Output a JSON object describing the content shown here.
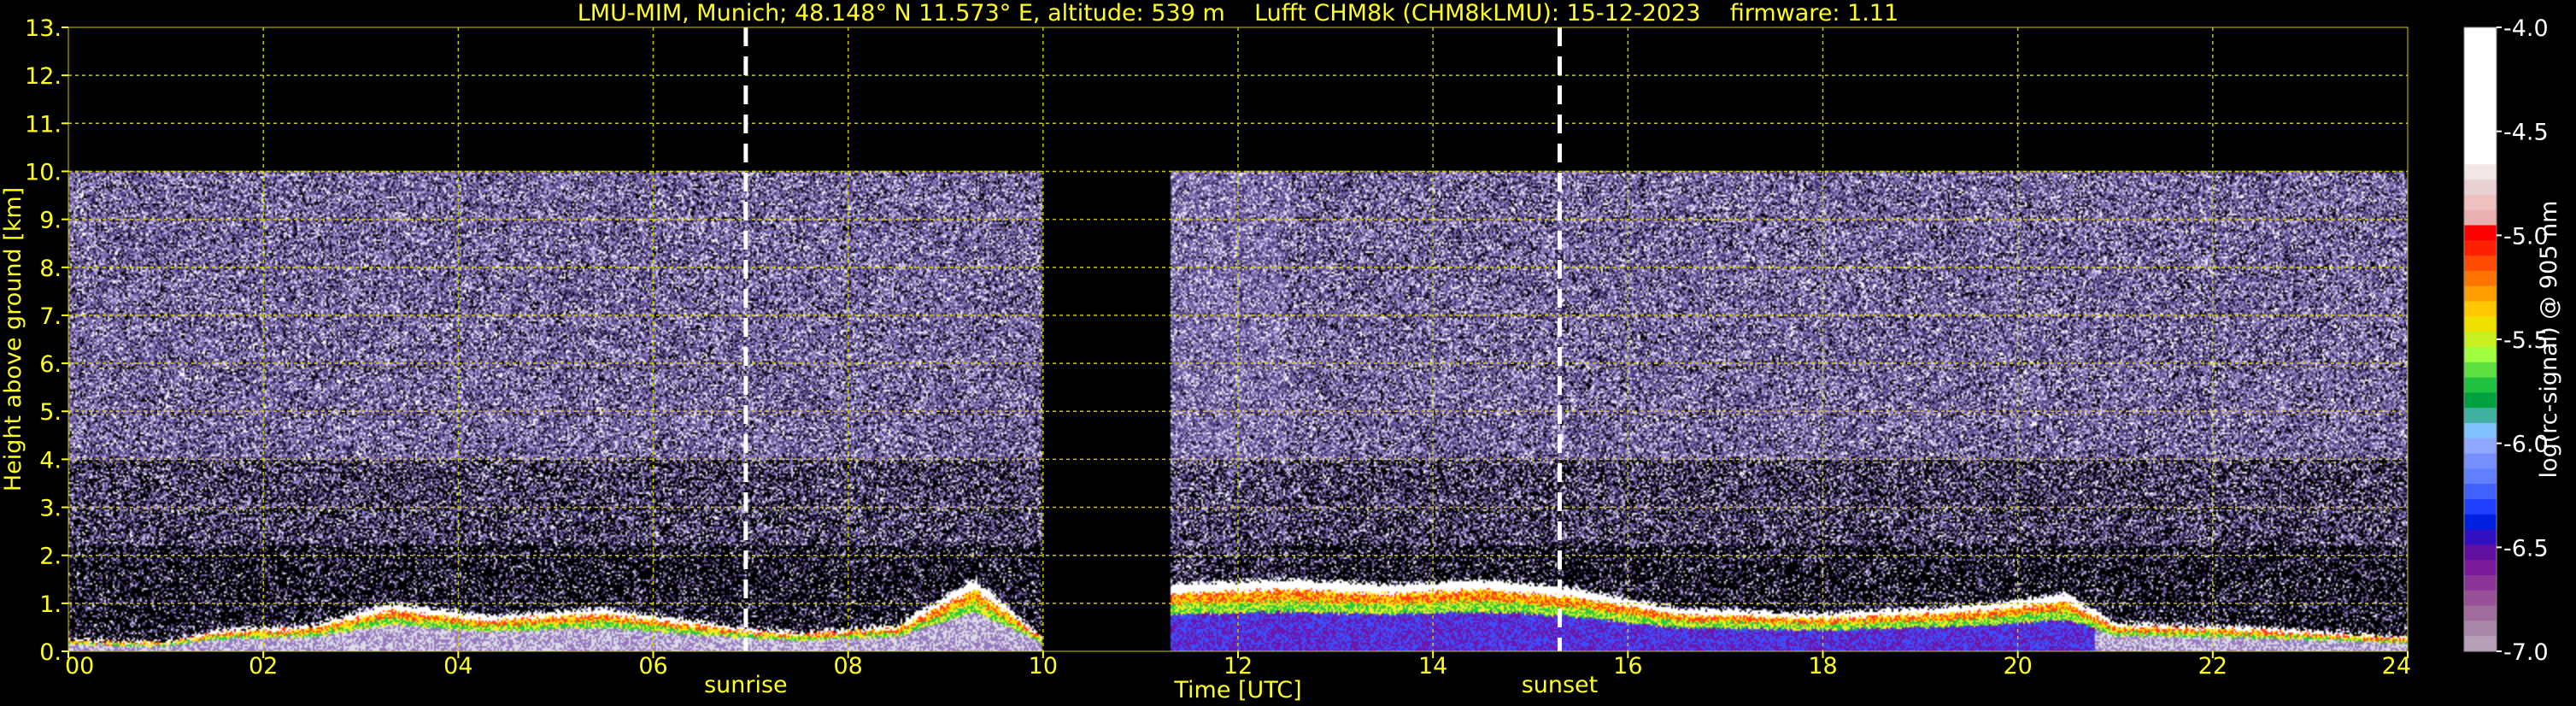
{
  "header": {
    "title": "LMU-MIM, Munich; 48.148° N 11.573° E, altitude: 539 m    Lufft CHM8k (CHM8kLMU): 15-12-2023    firmware: 1.11"
  },
  "colors": {
    "axis_text": "#ffff22",
    "grid": "#c8c800",
    "background": "#000000",
    "marker": "#ffffff",
    "colorbar_text": "#ffffff"
  },
  "chart_data": {
    "type": "heatmap",
    "title": "LMU-MIM, Munich; 48.148° N 11.573° E, altitude: 539 m    Lufft CHM8k (CHM8kLMU): 15-12-2023    firmware: 1.11",
    "xlabel": "Time [UTC]",
    "ylabel": "Height above ground [km]",
    "xlim": [
      0,
      24
    ],
    "ylim": [
      0,
      13
    ],
    "x_ticks": [
      "00",
      "02",
      "04",
      "06",
      "08",
      "10",
      "12",
      "14",
      "16",
      "18",
      "20",
      "22",
      "24"
    ],
    "y_ticks": [
      "0.",
      "1.",
      "2.",
      "3.",
      "4.",
      "5.",
      "6.",
      "7.",
      "8.",
      "9.",
      "10.",
      "11.",
      "12.",
      "13."
    ],
    "grid": true,
    "data_top_km": 10,
    "missing_data_interval_h": [
      10.0,
      11.3
    ],
    "markers": [
      {
        "label": "sunrise",
        "x": 6.95
      },
      {
        "label": "sunset",
        "x": 15.3
      }
    ],
    "colorbar": {
      "label": "log(rc-signal) @ 905 nm",
      "range": [
        -7.0,
        -4.0
      ],
      "ticks": [
        "-4.0",
        "-4.5",
        "-5.0",
        "-5.5",
        "-6.0",
        "-6.5",
        "-7.0"
      ],
      "colors": [
        "#ffffff",
        "#ffffff",
        "#ffffff",
        "#ffffff",
        "#ffffff",
        "#ffffff",
        "#ffffff",
        "#ffffff",
        "#ffffff",
        "#f2e6e6",
        "#ead2d2",
        "#eec0c0",
        "#e8b0b0",
        "#ff0000",
        "#ff2000",
        "#ff4a00",
        "#ff7400",
        "#ff9e00",
        "#ffc800",
        "#f0e000",
        "#c8f020",
        "#a0ff40",
        "#60e040",
        "#20c040",
        "#00a040",
        "#40b0a0",
        "#80c0ff",
        "#90a8ff",
        "#7890ff",
        "#6080ff",
        "#4060ff",
        "#2040ff",
        "#0020e0",
        "#3010c0",
        "#6010a0",
        "#7a1a9a",
        "#8a3498",
        "#985096",
        "#a06c9c",
        "#a888a8",
        "#b8a0b8"
      ]
    },
    "signal_profile": [
      {
        "t": 0.0,
        "h": 0.25
      },
      {
        "t": 1.0,
        "h": 0.2
      },
      {
        "t": 1.5,
        "h": 0.45
      },
      {
        "t": 2.5,
        "h": 0.55
      },
      {
        "t": 3.3,
        "h": 1.0
      },
      {
        "t": 4.3,
        "h": 0.75
      },
      {
        "t": 5.5,
        "h": 0.9
      },
      {
        "t": 6.9,
        "h": 0.5
      },
      {
        "t": 7.5,
        "h": 0.4
      },
      {
        "t": 8.5,
        "h": 0.55
      },
      {
        "t": 9.3,
        "h": 1.5
      },
      {
        "t": 10.0,
        "h": 0.3
      },
      {
        "t": 11.3,
        "h": 1.4
      },
      {
        "t": 12.5,
        "h": 1.5
      },
      {
        "t": 13.5,
        "h": 1.4
      },
      {
        "t": 14.5,
        "h": 1.5
      },
      {
        "t": 15.5,
        "h": 1.3
      },
      {
        "t": 16.5,
        "h": 0.9
      },
      {
        "t": 18.0,
        "h": 0.8
      },
      {
        "t": 19.5,
        "h": 0.95
      },
      {
        "t": 20.5,
        "h": 1.2
      },
      {
        "t": 21.0,
        "h": 0.6
      },
      {
        "t": 22.5,
        "h": 0.5
      },
      {
        "t": 24.0,
        "h": 0.3
      }
    ]
  }
}
